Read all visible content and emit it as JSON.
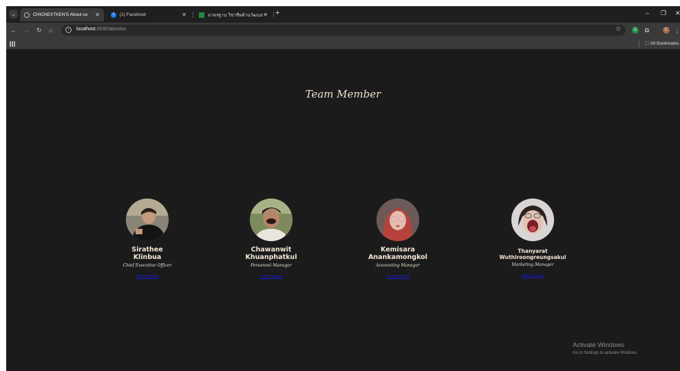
{
  "browser": {
    "tabs": [
      {
        "title": "CHICNEXTKEN'S About us",
        "active": true,
        "favicon": "globe-icon"
      },
      {
        "title": "(1) Facebook",
        "active": false,
        "favicon": "facebook-icon"
      },
      {
        "title": "มาตรฐาน วิชาชีพด้านวัฒนธรรม - G",
        "active": false,
        "favicon": "sheets-icon"
      }
    ],
    "url_host": "localhost",
    "url_path": ":3030/aboutus",
    "all_bookmarks_label": "All Bookmarks"
  },
  "page": {
    "title": "Team Member",
    "members": [
      {
        "first": "Sirathee",
        "last": "Klinbua",
        "role": "Chief Executive Officer",
        "email_label": "Send email"
      },
      {
        "first": "Chawanwit",
        "last": "Khuanphatkul",
        "role": "Personnel Manager",
        "email_label": "Send email"
      },
      {
        "first": "Kemisara",
        "last": "Anankamongkol",
        "role": "Accounting Manager",
        "email_label": "Send email"
      },
      {
        "first": "Thanyarat",
        "last": "Wuthiroongreungsakul",
        "role": "Marketing Manager",
        "email_label": "Send email"
      }
    ]
  },
  "os_watermark": {
    "line1": "Activate Windows",
    "line2": "Go to Settings to activate Windows."
  },
  "colors": {
    "page_bg": "#1b1b1b",
    "title_text": "#f1e2cf",
    "link": "#1a1adc"
  }
}
